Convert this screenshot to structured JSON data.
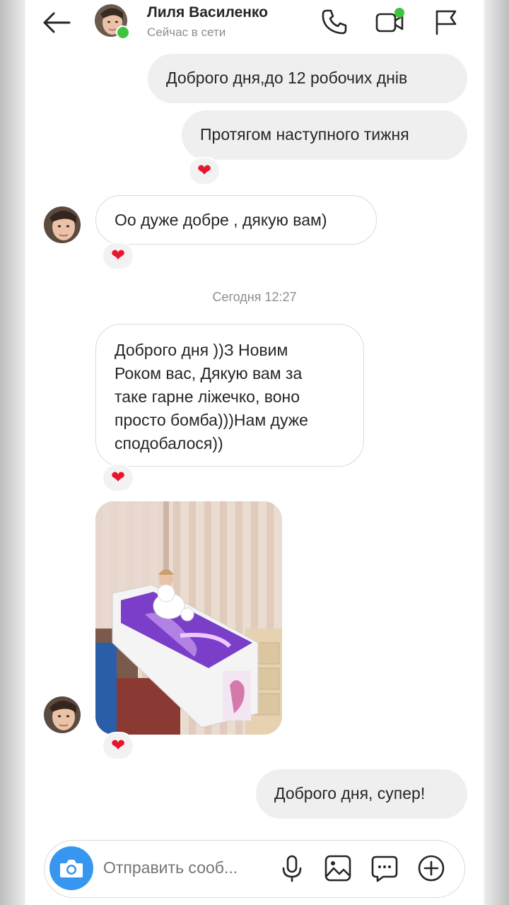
{
  "header": {
    "contact_name": "Лиля Василенко",
    "status": "Сейчас в сети"
  },
  "messages": {
    "out_1": "Доброго дня,до 12 робочих днів",
    "out_2": "Протягом наступного тижня",
    "in_1": "Оо дуже добре , дякую вам)",
    "time_separator": "Сегодня 12:27",
    "in_2_lines": [
      "Доброго дня ))З Новим",
      "Роком вас, Дякую вам за",
      "таке гарне ліжечко, воно",
      "просто бомба)))Нам дуже",
      "сподобалося))"
    ],
    "out_3": "Доброго дня, супер!"
  },
  "reactions": {
    "heart": "❤"
  },
  "composer": {
    "placeholder": "Отправить сооб..."
  },
  "colors": {
    "accent": "#3797f0",
    "online": "#3fc43f",
    "heart": "#e8152c",
    "outgoing_bubble": "#efefef"
  },
  "icons": [
    "back-arrow-icon",
    "phone-icon",
    "video-icon",
    "flag-icon",
    "camera-icon",
    "microphone-icon",
    "gallery-icon",
    "sticker-icon",
    "plus-icon"
  ]
}
